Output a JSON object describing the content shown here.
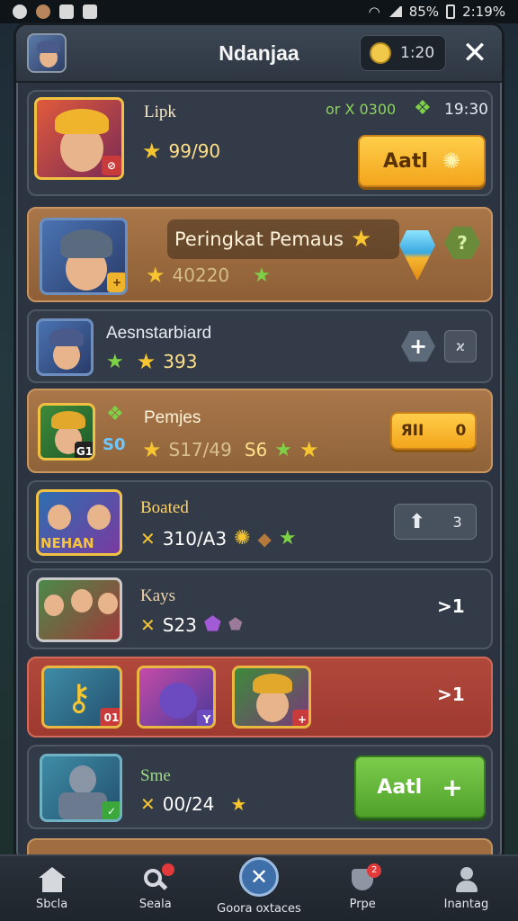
{
  "status_bar": {
    "battery": "85%",
    "time": "2:19%"
  },
  "header": {
    "title": "Ndanjaa",
    "timer": "1:20"
  },
  "rows": [
    {
      "name": "Lipk",
      "score": "99/90",
      "currency": "or X 0300",
      "time": "19:30",
      "button": "Aatl"
    },
    {
      "title": "Peringkat Pemaus",
      "score": "40220",
      "hex_label": "?"
    },
    {
      "name": "Aesnstarbiard",
      "score": "393",
      "right_btn": "ϰ"
    },
    {
      "name": "Pemjes",
      "score": "S17/49",
      "extra": "S6",
      "badge": "G1",
      "badge2": "S0",
      "pill_left": "ЯII",
      "pill_right": "0"
    },
    {
      "name": "Boated",
      "score": "310/A3",
      "banner": "NEHAN",
      "pill_right": "3"
    },
    {
      "name": "Kays",
      "score": "S23",
      "action": ">1"
    },
    {
      "badge": "01",
      "action": ">1"
    },
    {
      "name": "Sme",
      "score": "00/24",
      "button": "Aatl"
    }
  ],
  "nav": [
    {
      "label": "Sbcla"
    },
    {
      "label": "Seala"
    },
    {
      "label": "Goora oxtaces"
    },
    {
      "label": "Prpe",
      "badge": "2"
    },
    {
      "label": "Inantag"
    }
  ]
}
